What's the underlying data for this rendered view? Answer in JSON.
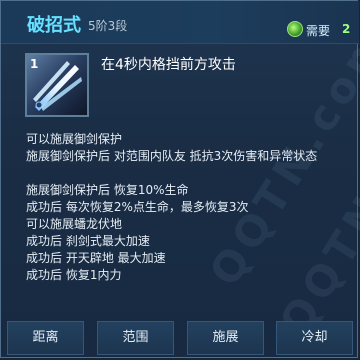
{
  "skill": {
    "name": "破招式",
    "rank": "5阶3段",
    "need_label": "需要",
    "need_value": "2",
    "icon_level": "1",
    "short_desc": "在4秒内格挡前方攻击"
  },
  "details": [
    "可以施展御剑保护",
    "施展御剑保护后 对范围内队友 抵抗3次伤害和异常状态",
    "施展御剑保护后 恢复10%生命",
    "成功后 每次恢复2%点生命，最多恢复3次",
    "可以施展蟠龙伏地",
    "成功后 刹剑式最大加速",
    "成功后 开天辟地 最大加速",
    "成功后 恢复1内力"
  ],
  "footer": {
    "buttons": [
      "距离",
      "范围",
      "施展",
      "冷却"
    ]
  },
  "watermark": "QQTN.com",
  "colors": {
    "title": "#66e0ff",
    "text": "#e6eef6",
    "need_value": "#9bff7f"
  }
}
